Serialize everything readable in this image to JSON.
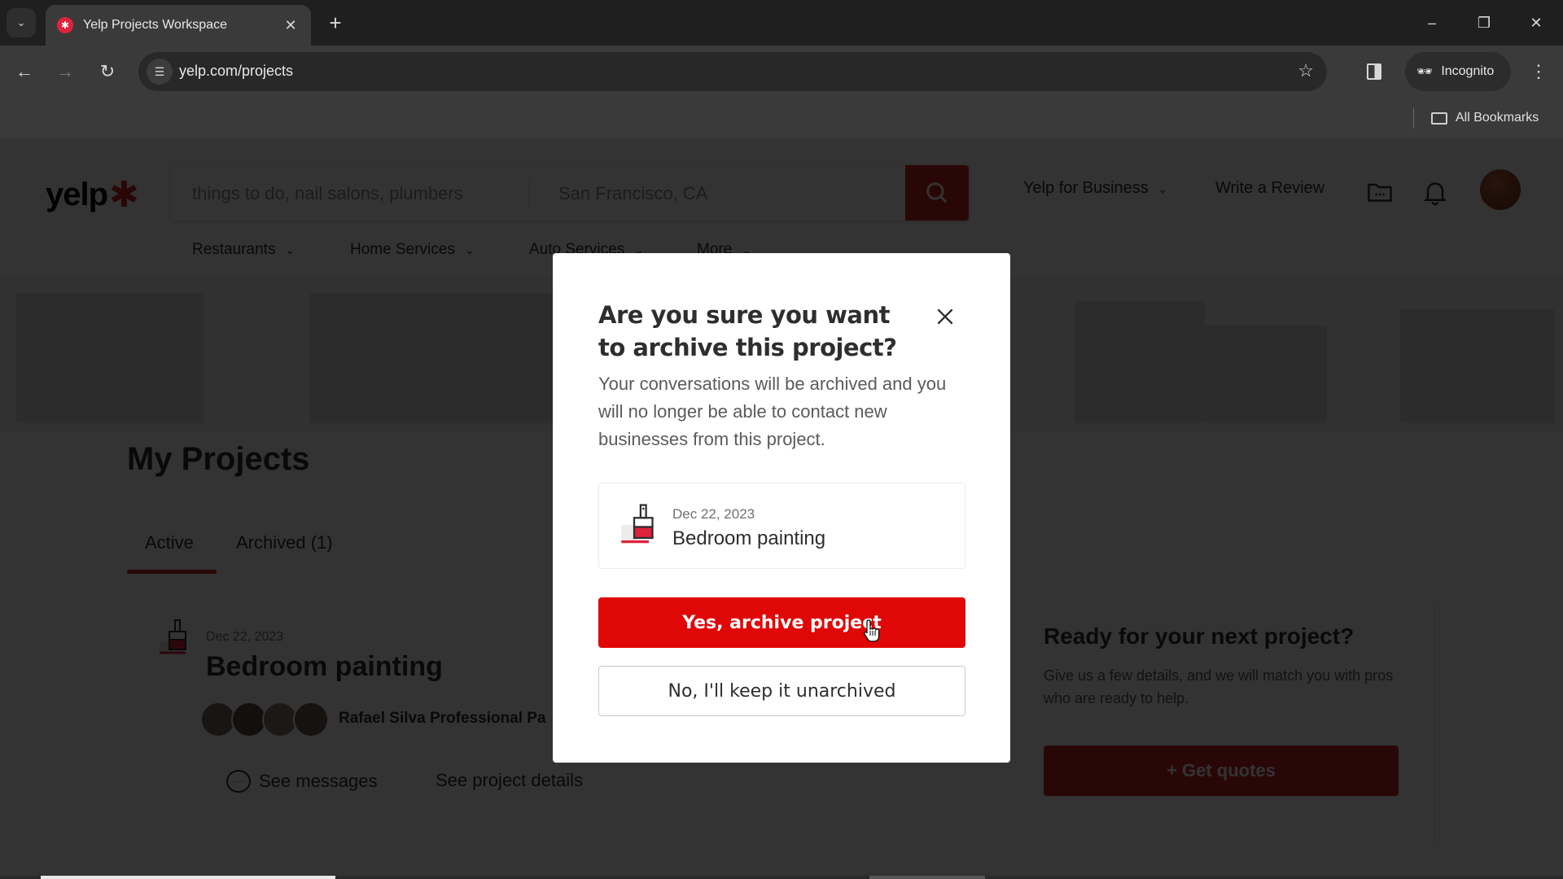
{
  "browser": {
    "tab_title": "Yelp Projects Workspace",
    "url": "yelp.com/projects",
    "incognito_label": "Incognito",
    "bookmarks_label": "All Bookmarks",
    "icons": {
      "tab_search": "chevron-down-icon",
      "favicon": "yelp-burst-icon",
      "close_tab": "close-icon",
      "new_tab": "plus-icon",
      "back": "arrow-left-icon",
      "forward": "arrow-right-icon",
      "reload": "reload-icon",
      "site_info": "tune-icon",
      "bookmark": "star-icon",
      "side_panel": "side-panel-icon",
      "incognito": "incognito-icon",
      "menu": "kebab-menu-icon",
      "folder": "folder-icon",
      "minimize": "minimize-icon",
      "restore": "restore-icon",
      "close_window": "close-icon"
    },
    "glyphs": {
      "tab_search": "⌄",
      "favicon": "✱",
      "close_tab": "✕",
      "new_tab": "+",
      "back": "←",
      "forward": "→",
      "reload": "↻",
      "site_info": "☰",
      "bookmark": "☆",
      "incognito": "🕶",
      "menu": "⋮",
      "minimize": "–",
      "restore": "❐",
      "close_window": "✕"
    }
  },
  "header": {
    "logo_text": "yelp",
    "logo_burst": "✱",
    "search_find_placeholder": "things to do, nail salons, plumbers",
    "search_near_value": "San Francisco, CA",
    "yelp_for_business": "Yelp for Business",
    "write_review": "Write a Review",
    "chevron": "⌄",
    "categories": [
      {
        "label": "Restaurants"
      },
      {
        "label": "Home Services"
      },
      {
        "label": "Auto Services"
      },
      {
        "label": "More"
      }
    ],
    "category_chevron": "⌄"
  },
  "projects": {
    "title": "My Projects",
    "tabs": [
      {
        "label": "Active",
        "selected": true
      },
      {
        "label": "Archived (1)",
        "selected": false
      }
    ],
    "item": {
      "date": "Dec 22, 2023",
      "title": "Bedroom painting",
      "pro_name": "Rafael Silva Professional Pa",
      "see_messages": "See messages",
      "see_details": "See project details"
    }
  },
  "next_project": {
    "title": "Ready for your next project?",
    "description": "Give us a few details, and we will match you with pros who are ready to help.",
    "button": "+ Get quotes"
  },
  "modal": {
    "title": "Are you sure you want to archive this project?",
    "body": "Your conversations will be archived and you will no longer be able to contact new businesses from this project.",
    "project_date": "Dec 22, 2023",
    "project_title": "Bedroom painting",
    "confirm_button": "Yes, archive project",
    "cancel_button": "No, I'll keep it unarchived"
  },
  "colors": {
    "brand_red": "#d32323",
    "confirm_red": "#e00707",
    "text_dark": "#2d2e2f"
  }
}
